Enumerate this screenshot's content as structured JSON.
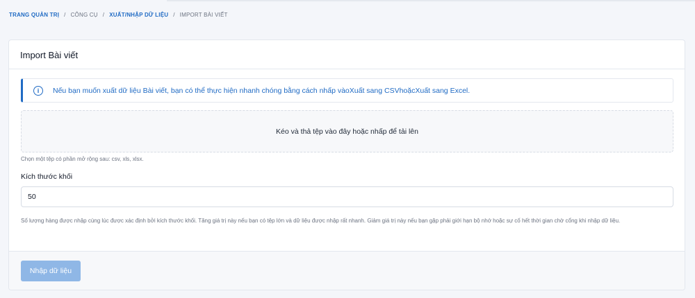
{
  "breadcrumb": {
    "items": [
      {
        "label": "Trang quản trị"
      },
      {
        "label": "Công cụ"
      },
      {
        "label": "Xuất/Nhập dữ liệu"
      },
      {
        "label": "Import Bài viết"
      }
    ],
    "separator": "/"
  },
  "card": {
    "title": "Import Bài viết",
    "alert": {
      "icon": "info-icon",
      "text_prefix": "Nếu bạn muốn xuất dữ liệu Bài viết, bạn có thể thực hiện nhanh chóng bằng cách nhấp vào",
      "link_csv": "Xuất sang CSV",
      "middle": "hoặc",
      "link_excel": "Xuất sang Excel",
      "suffix": "."
    },
    "dropzone": {
      "text": "Kéo và thả tệp vào đây hoặc nhấp để tải lên"
    },
    "extension_hint": "Chọn một tệp có phần mở rộng sau: csv, xls, xlsx.",
    "chunk_size": {
      "label": "Kích thước khối",
      "value": "50",
      "help": "Số lượng hàng được nhập cùng lúc được xác định bởi kích thước khối. Tăng giá trị này nếu bạn có tệp lớn và dữ liệu được nhập rất nhanh. Giảm giá trị này nếu bạn gặp phải giới hạn bộ nhớ hoặc sự cố hết thời gian chờ cổng khi nhập dữ liệu."
    },
    "footer": {
      "import_button": "Nhập dữ liệu"
    }
  },
  "colors": {
    "accent": "#206bc4",
    "button_disabled": "#8fb7e6",
    "background": "#f4f6fa"
  }
}
